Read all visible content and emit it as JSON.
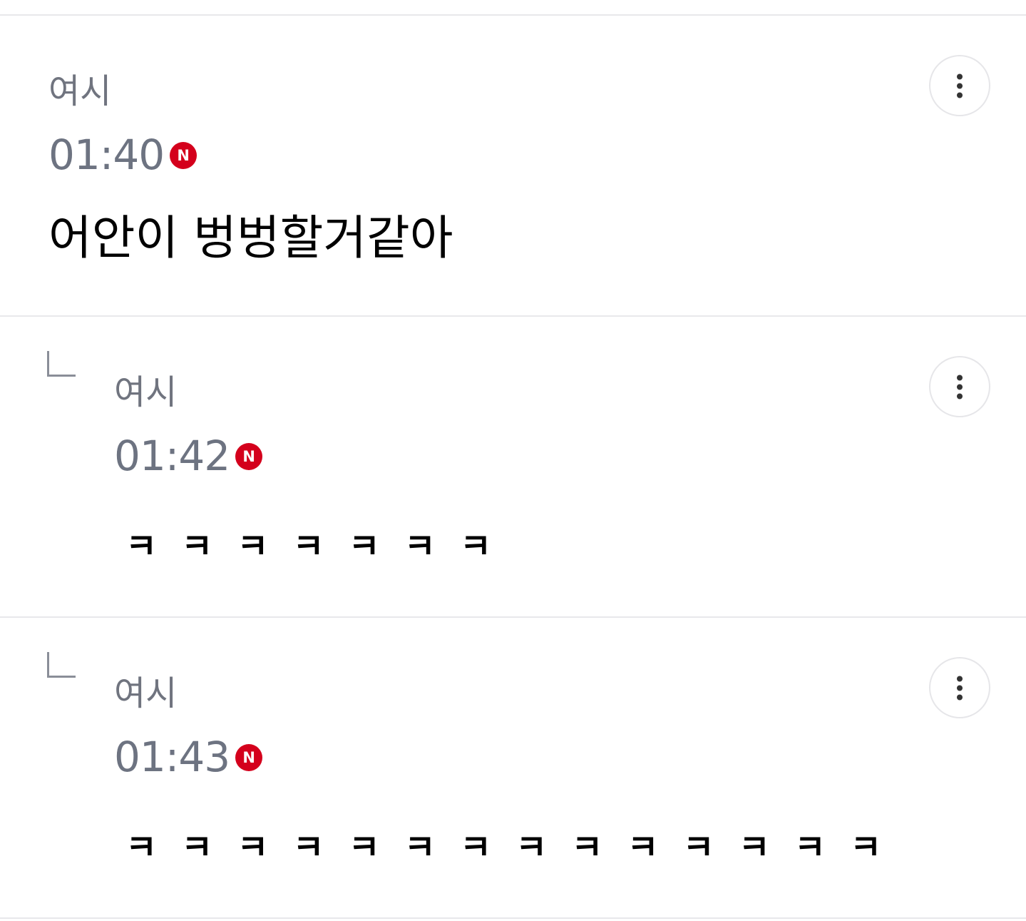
{
  "comments": [
    {
      "author": "여시",
      "time": "01:40",
      "badge": "N",
      "text": "어안이 벙벙할거같아",
      "is_reply": false
    },
    {
      "author": "여시",
      "time": "01:42",
      "badge": "N",
      "text": "ㅋㅋㅋㅋㅋㅋㅋ",
      "is_reply": true
    },
    {
      "author": "여시",
      "time": "01:43",
      "badge": "N",
      "text": "ㅋㅋㅋㅋㅋㅋㅋㅋㅋㅋㅋㅋㅋㅋ",
      "is_reply": true
    }
  ],
  "icons": {
    "more": "more-vertical-icon",
    "reply": "reply-arrow-icon",
    "new": "new-badge-icon"
  },
  "colors": {
    "new_badge": "#d4001c",
    "meta_text": "#6d7381",
    "divider": "#e8e8eb"
  }
}
